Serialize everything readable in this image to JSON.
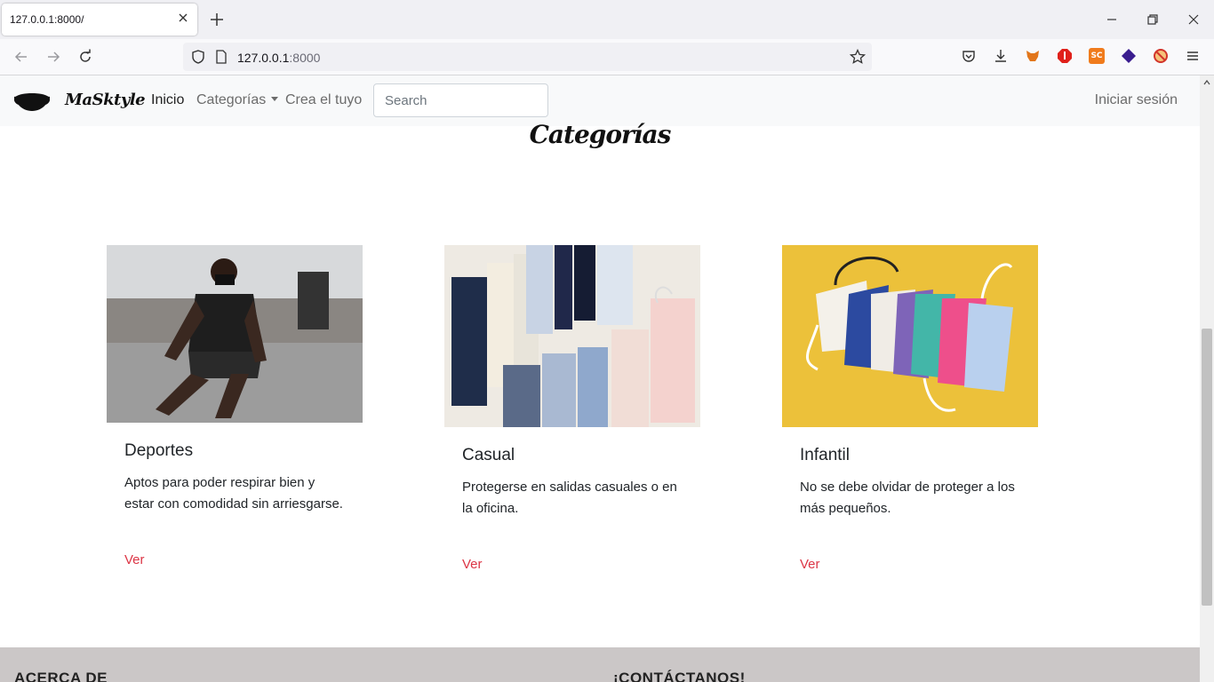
{
  "browser": {
    "tab_title": "127.0.0.1:8000/",
    "url_host": "127.0.0.1",
    "url_port": ":8000"
  },
  "site": {
    "brand": "MaSktyle",
    "nav": {
      "home": "Inicio",
      "categories": "Categorías",
      "create": "Crea el tuyo",
      "search_placeholder": "Search",
      "login": "Iniciar sesión"
    },
    "heading": "Categorías",
    "cards": [
      {
        "title": "Deportes",
        "text": "Aptos para poder respirar bien y estar con comodidad sin arriesgarse.",
        "link": "Ver"
      },
      {
        "title": "Casual",
        "text": "Protegerse en salidas casuales o en la oficina.",
        "link": "Ver"
      },
      {
        "title": "Infantil",
        "text": "No se debe olvidar de proteger a los más pequeños.",
        "link": "Ver"
      }
    ],
    "footer": {
      "about": "ACERCA DE",
      "contact": "¡CONTÁCTANOS!"
    }
  },
  "colors": {
    "accent_link": "#dc3545",
    "footer_bg": "#cbc7c7",
    "infantil_bg": "#ecc13a"
  }
}
